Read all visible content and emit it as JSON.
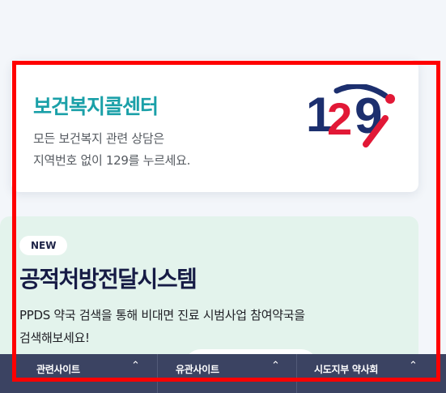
{
  "call_center": {
    "title": "보건복지콜센터",
    "desc_line1": "모든 보건복지 관련 상담은",
    "desc_line2": "지역번호 없이 129를 누르세요.",
    "logo_text": "129"
  },
  "ppds": {
    "badge": "NEW",
    "title": "공적처방전달시스템",
    "desc_line1": "PPDS 약국 검색을 통해 비대면 진료 시범사업 참여약국을",
    "desc_line2": "검색해보세요!"
  },
  "footer": {
    "tabs": [
      {
        "label": "관련사이트",
        "icon": "chevron-up-icon"
      },
      {
        "label": "유관사이트",
        "icon": "chevron-up-icon"
      },
      {
        "label": "시도지부 약사회",
        "icon": "chevron-up-icon"
      }
    ]
  },
  "colors": {
    "title_teal": "#1aa0a8",
    "logo_navy": "#1c2f6e",
    "logo_red": "#e21836",
    "ppds_bg": "#e3f3ec",
    "footer_bg": "#3b4362",
    "highlight_red": "#ff0000"
  }
}
